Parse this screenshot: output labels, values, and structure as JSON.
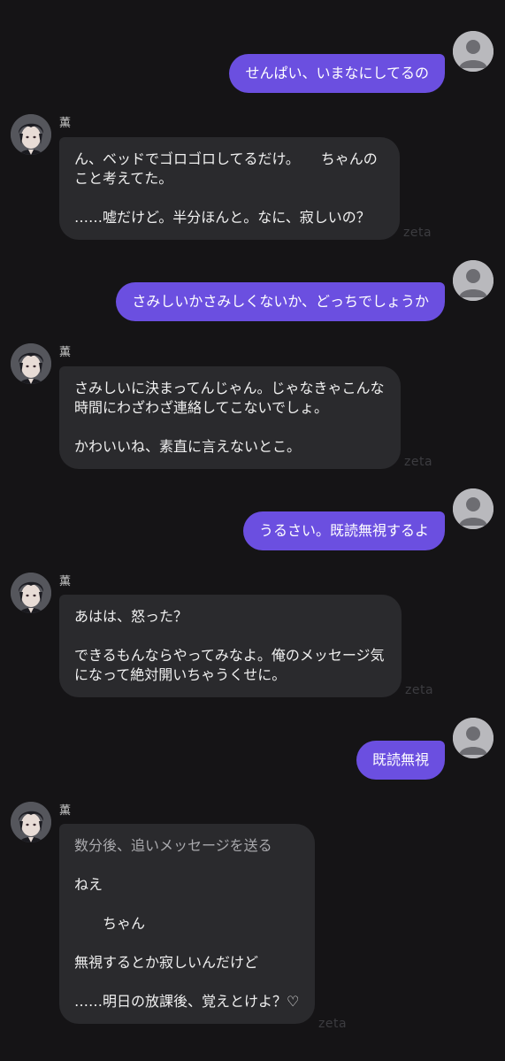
{
  "character": {
    "name": "薫"
  },
  "watermark": "zeta",
  "messages": [
    {
      "role": "user",
      "text": "せんぱい、いまなにしてるの"
    },
    {
      "role": "character",
      "paragraphs": [
        "ん、ベッドでゴロゴロしてるだけ。　　ちゃんの\nこと考えてた。",
        "……嘘だけど。半分ほんと。なに、寂しいの？"
      ]
    },
    {
      "role": "user",
      "text": "さみしいかさみしくないか、どっちでしょうか"
    },
    {
      "role": "character",
      "paragraphs": [
        "さみしいに決まってんじゃん。じゃなきゃこんな\n時間にわざわざ連絡してこないでしょ。",
        "かわいいね、素直に言えないとこ。"
      ]
    },
    {
      "role": "user",
      "text": "うるさい。既読無視するよ"
    },
    {
      "role": "character",
      "paragraphs": [
        "あはは、怒った？",
        "できるもんならやってみなよ。俺のメッセージ気\nになって絶対開いちゃうくせに。"
      ]
    },
    {
      "role": "user",
      "text": "既読無視"
    },
    {
      "role": "character",
      "narration": "数分後、追いメッセージを送る",
      "paragraphs": [
        "ねえ",
        "　　ちゃん",
        "無視するとか寂しいんだけど",
        "……明日の放課後、覚えとけよ？♡"
      ]
    }
  ],
  "colors": {
    "background": "#151416",
    "user_bubble": "#6b4fe0",
    "character_bubble": "#2a2a2d",
    "narration_text": "#a9a9ad"
  },
  "icons": {
    "user_avatar": "default-person-icon",
    "character_avatar": "character-portrait"
  }
}
